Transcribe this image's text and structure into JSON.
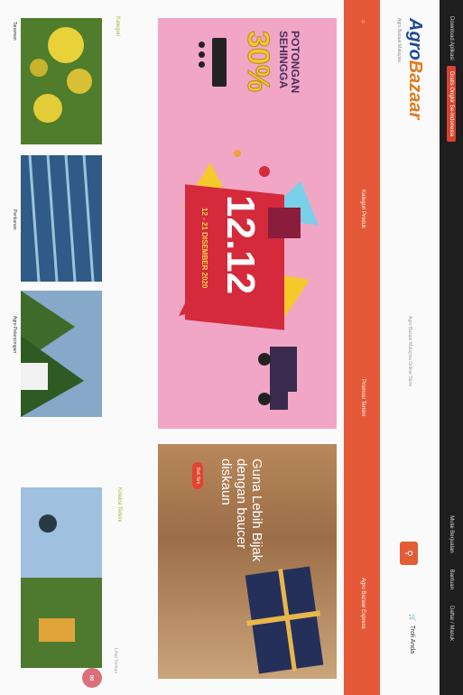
{
  "topbar": {
    "left_text": "Download Aplikasi",
    "red_tag": "Gratis Ongkir Se-Indonesia",
    "right_links": [
      "Mulai Berjualan",
      "Bantuan",
      "Daftar / Masuk"
    ]
  },
  "header": {
    "logo_agro": "Agro",
    "logo_bazaar": "Bazaar",
    "logo_subtitle": "Agro Bazaar Malaysia",
    "tagline": "Agro Bazaar Malaysia Online Store",
    "cart_label": "Troli Anda",
    "icons": {
      "search": "search-icon",
      "cart": "cart-icon"
    }
  },
  "nav": {
    "home_icon": "home-icon",
    "items": [
      "Kategori Produk",
      "Promosi Terkini",
      "Agro Bazaar Express"
    ]
  },
  "banner_main": {
    "promo_line1": "POTONGAN",
    "promo_line2": "SEHINGGA",
    "promo_pct": "30%",
    "big_date": "12.12",
    "date_range": "12 - 21 DISEMBER 2020"
  },
  "banner_side": {
    "headline_line1": "Guna Lebih Bijak",
    "headline_line2": "dengan baucer",
    "headline_line3": "diskaun",
    "pill": "Beli Sini"
  },
  "sections": {
    "categories_title": "Kategori",
    "popular_title": "Koleksi Terkini",
    "see_all": "Lihat Semua"
  },
  "categories": [
    {
      "label": "Tanaman"
    },
    {
      "label": "Perikanan"
    },
    {
      "label": "Agro Pelancongan"
    }
  ],
  "colors": {
    "accent": "#e45a38",
    "brand_blue": "#1f4a96",
    "brand_orange": "#e07a1e",
    "section_green": "#a8b53a"
  }
}
